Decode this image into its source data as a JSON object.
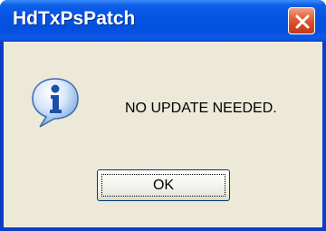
{
  "window": {
    "title": "HdTxPsPatch",
    "close_icon": "close-icon"
  },
  "dialog": {
    "icon": "info-icon",
    "message": "NO UPDATE NEEDED.",
    "ok_label": "OK"
  }
}
